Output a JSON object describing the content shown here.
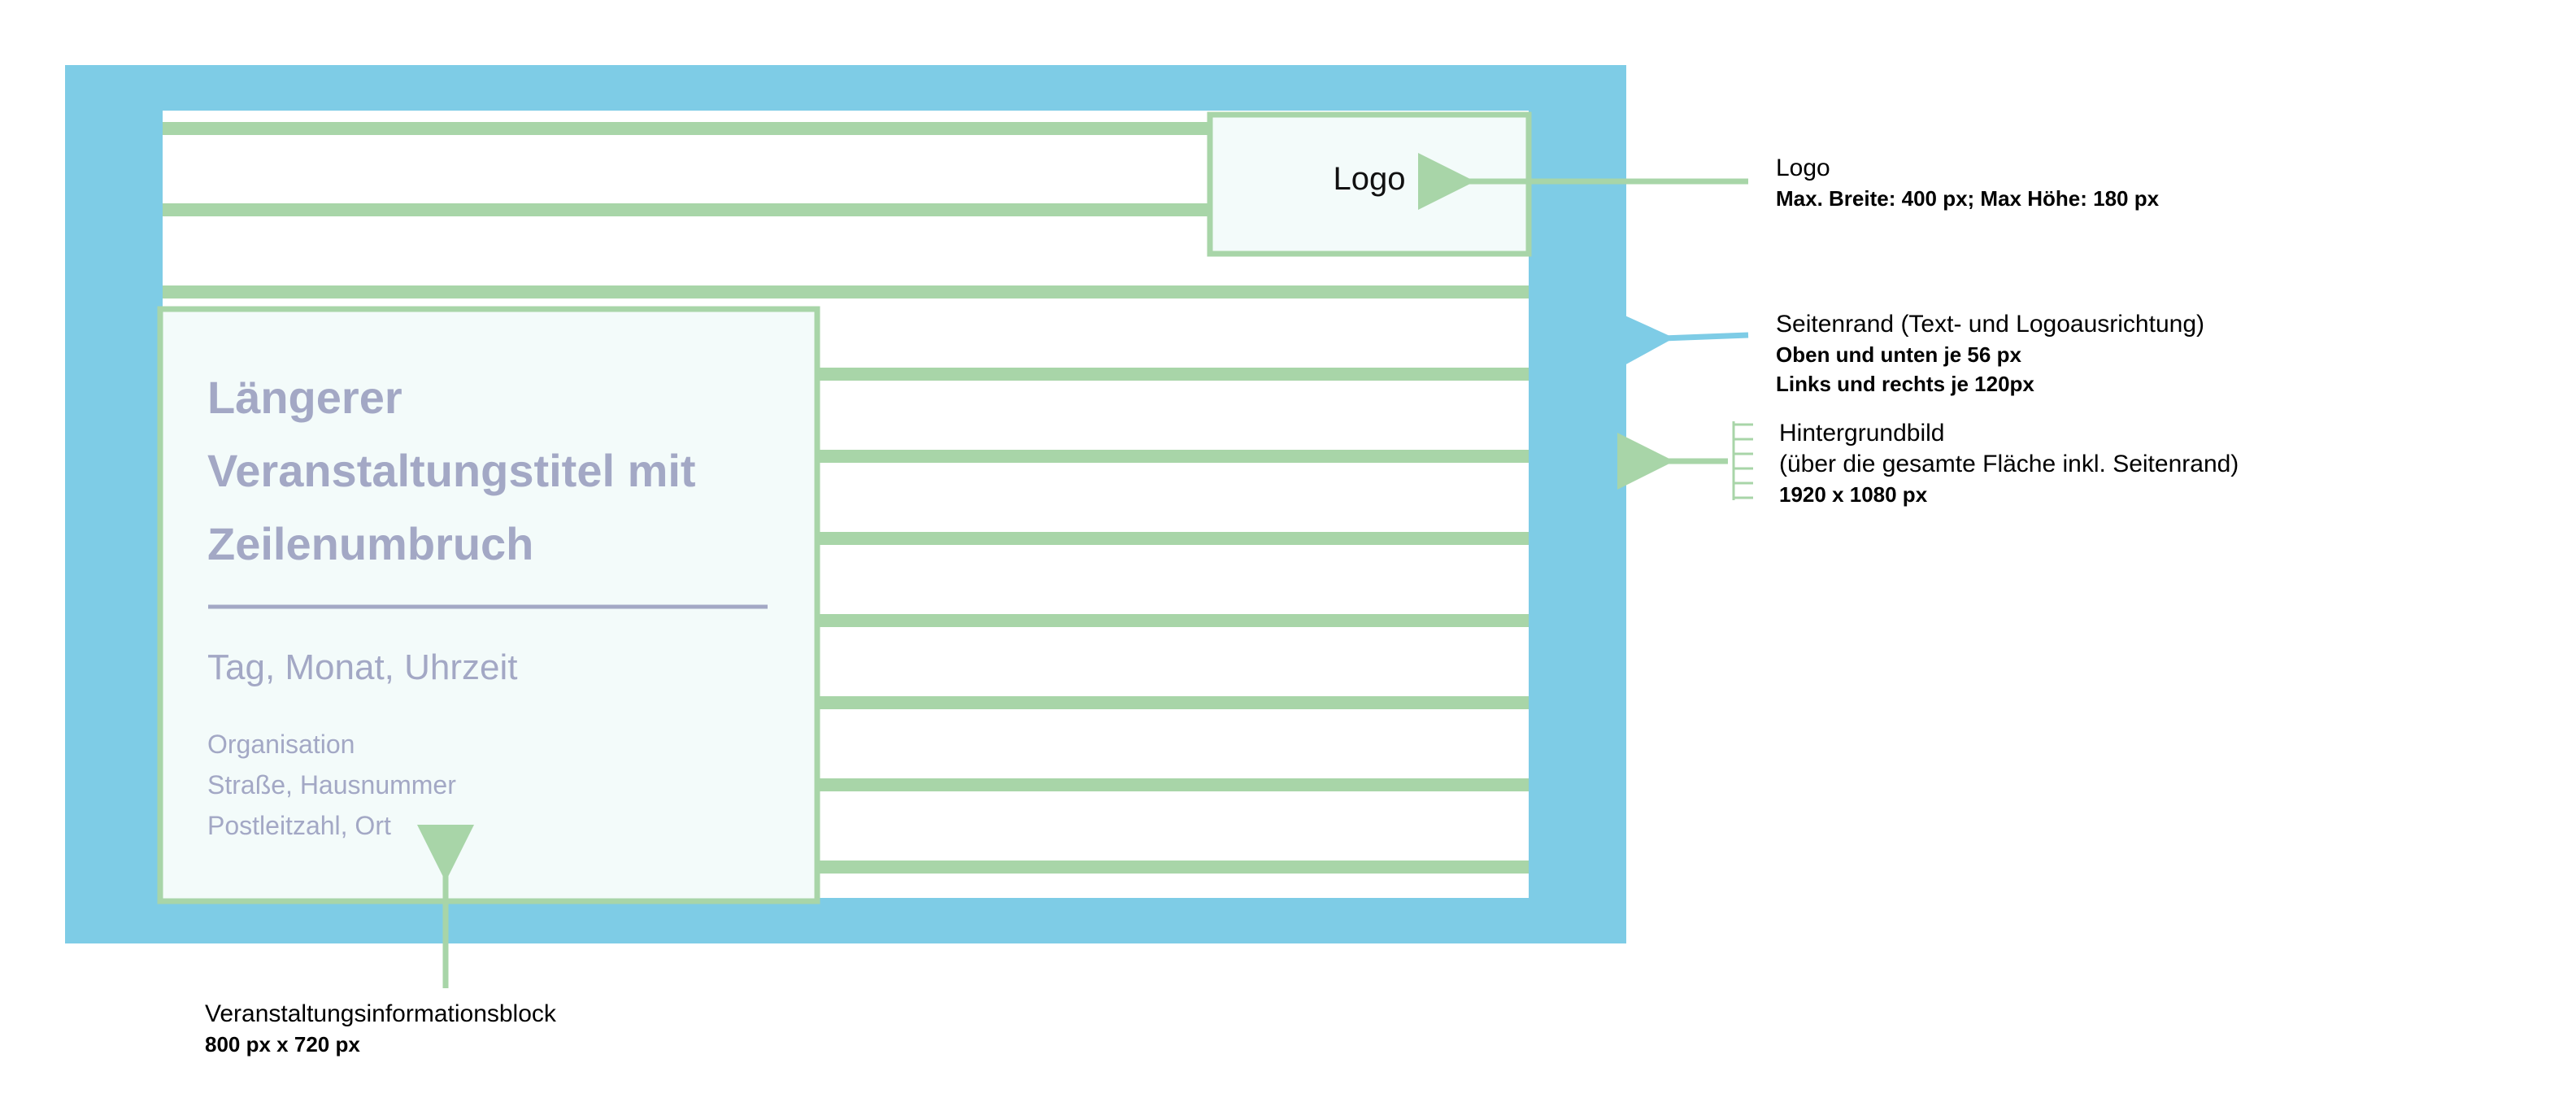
{
  "colors": {
    "margin_blue": "#7ecce6",
    "green": "#a8d5a8",
    "box_fill": "#f3fbfa",
    "muted_text": "#a3a8c5"
  },
  "logo_box": {
    "label": "Logo"
  },
  "event_block": {
    "title_lines": [
      "Längerer",
      "Veranstaltungstitel mit",
      "Zeilenumbruch"
    ],
    "date_line": "Tag, Monat, Uhrzeit",
    "address_lines": [
      "Organisation",
      "Straße, Hausnummer",
      "Postleitzahl, Ort"
    ]
  },
  "annotations": {
    "logo": {
      "title": "Logo",
      "detail": "Max. Breite: 400 px; Max Höhe: 180 px"
    },
    "margin": {
      "title": "Seitenrand (Text- und Logoausrichtung)",
      "detail_1": "Oben und unten je 56 px",
      "detail_2": "Links und rechts je 120px"
    },
    "background": {
      "title": "Hintergrundbild",
      "subtitle": "(über die gesamte Fläche inkl. Seitenrand)",
      "detail": "1920 x 1080 px",
      "icon": "image-stack-icon"
    },
    "info_block": {
      "title": "Veranstaltungsinformationsblock",
      "detail": "800 px x 720 px"
    }
  }
}
